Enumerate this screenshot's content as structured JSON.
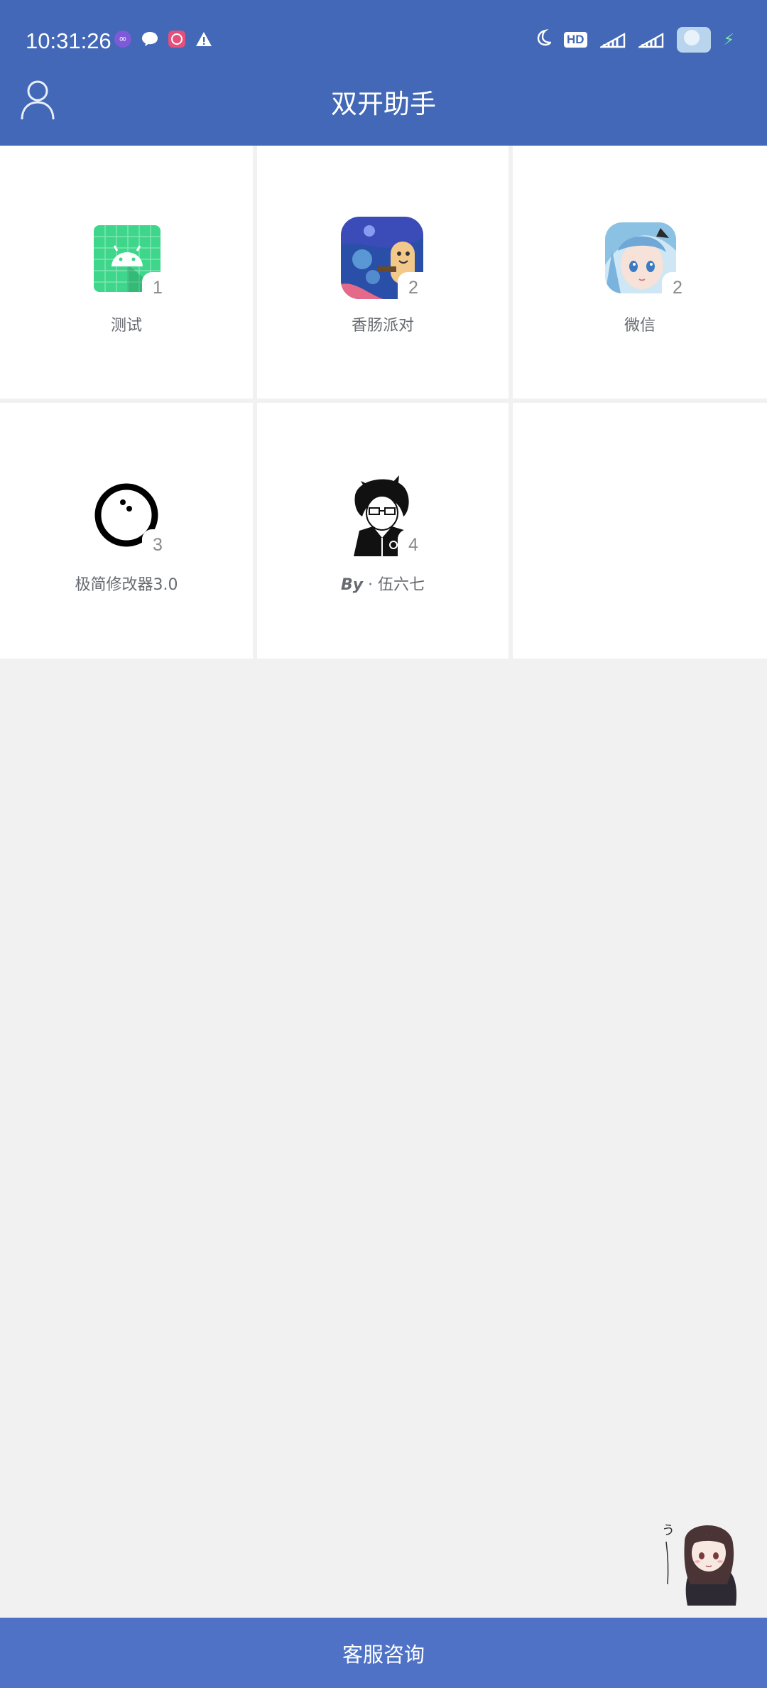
{
  "status_bar": {
    "time": "10:31:26",
    "hd_label": "HD",
    "icons_left": [
      "infinity-app-icon",
      "chat-bubble-icon",
      "pink-app-icon",
      "warning-icon"
    ],
    "icons_right": [
      "moon-icon",
      "hd-icon",
      "signal-icon",
      "signal-icon",
      "battery-avatar-icon"
    ]
  },
  "header": {
    "title": "双开助手",
    "profile_icon": "user-profile-icon",
    "color": "#4268b7"
  },
  "apps": [
    {
      "name": "测试",
      "count": "1",
      "icon": "android-icon"
    },
    {
      "name": "香肠派对",
      "count": "2",
      "icon": "sausage-party-icon"
    },
    {
      "name": "微信",
      "count": "2",
      "icon": "anime-girl-icon"
    },
    {
      "name": "极简修改器3.0",
      "count": "3",
      "icon": "ring-icon"
    },
    {
      "name_prefix": "By",
      "name": " · 伍六七",
      "count": "4",
      "icon": "anime-boy-icon"
    }
  ],
  "footer": {
    "label": "客服咨询",
    "color": "#4f72c7"
  }
}
